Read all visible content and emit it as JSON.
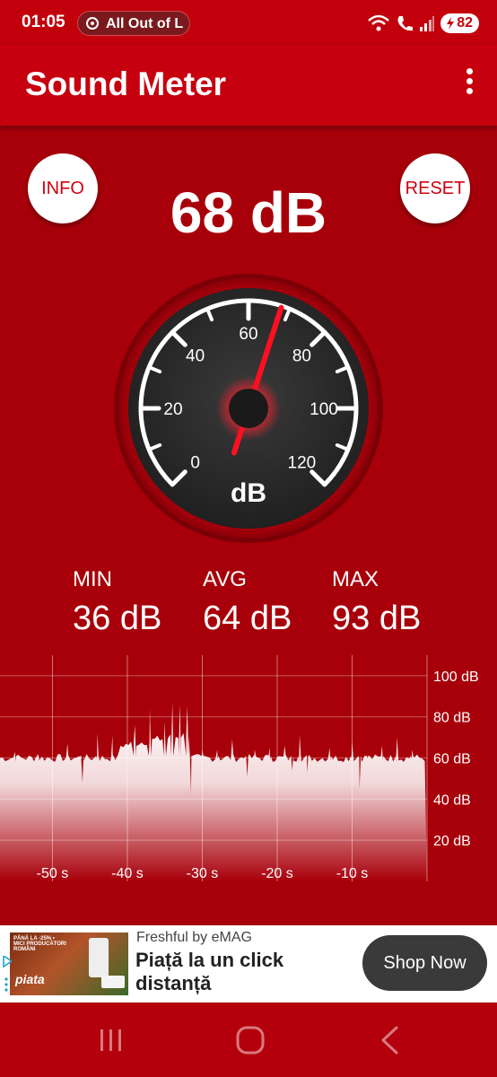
{
  "status_bar": {
    "time": "01:05",
    "media_title": "All Out of L",
    "battery": "82"
  },
  "app_bar": {
    "title": "Sound Meter"
  },
  "buttons": {
    "info": "INFO",
    "reset": "RESET"
  },
  "reading": {
    "current": "68 dB",
    "gauge_value": 68
  },
  "gauge": {
    "tick_labels": [
      "0",
      "20",
      "40",
      "60",
      "80",
      "100",
      "120"
    ],
    "unit": "dB",
    "range": [
      0,
      120
    ]
  },
  "stats": [
    {
      "label": "MIN",
      "value": "36 dB"
    },
    {
      "label": "AVG",
      "value": "64 dB"
    },
    {
      "label": "MAX",
      "value": "93 dB"
    }
  ],
  "chart_data": {
    "type": "area",
    "x_tick_labels": [
      "-50 s",
      "-40 s",
      "-30 s",
      "-20 s",
      "-10 s"
    ],
    "y_tick_labels": [
      "100 dB",
      "80 dB",
      "60 dB",
      "40 dB",
      "20 dB"
    ],
    "x_range": [
      -57,
      0
    ],
    "ylim": [
      0,
      110
    ],
    "baseline_db": 60,
    "peaks": [
      {
        "t": -55,
        "db": 63
      },
      {
        "t": -52,
        "db": 62
      },
      {
        "t": -48,
        "db": 67
      },
      {
        "t": -46,
        "db": 48
      },
      {
        "t": -44,
        "db": 72
      },
      {
        "t": -42,
        "db": 71
      },
      {
        "t": -39,
        "db": 76
      },
      {
        "t": -37,
        "db": 84
      },
      {
        "t": -35,
        "db": 78
      },
      {
        "t": -34,
        "db": 87
      },
      {
        "t": -33,
        "db": 86
      },
      {
        "t": -32,
        "db": 85
      },
      {
        "t": -31.5,
        "db": 43
      },
      {
        "t": -30,
        "db": 64
      },
      {
        "t": -28,
        "db": 64
      },
      {
        "t": -26,
        "db": 69
      },
      {
        "t": -24,
        "db": 51
      },
      {
        "t": -23,
        "db": 64
      },
      {
        "t": -21,
        "db": 65
      },
      {
        "t": -19,
        "db": 66
      },
      {
        "t": -18,
        "db": 54
      },
      {
        "t": -17,
        "db": 71
      },
      {
        "t": -16,
        "db": 53
      },
      {
        "t": -13,
        "db": 65
      },
      {
        "t": -10,
        "db": 68
      },
      {
        "t": -9,
        "db": 45
      },
      {
        "t": -8,
        "db": 61
      },
      {
        "t": -6,
        "db": 66
      },
      {
        "t": -4,
        "db": 70
      },
      {
        "t": -2,
        "db": 64
      }
    ]
  },
  "ad": {
    "sponsor": "Freshful by eMAG",
    "headline": "Piață la un click distanță",
    "cta": "Shop Now",
    "image_badge": "PÂNĂ LA -25% • MICI PRODUCĂTORI ROMÂNI",
    "image_logo": "piata"
  },
  "colors": {
    "background": "#a8000a",
    "app_bar": "#c6000e",
    "needle": "#ff1020",
    "gauge_face": "#2a2a2a"
  }
}
